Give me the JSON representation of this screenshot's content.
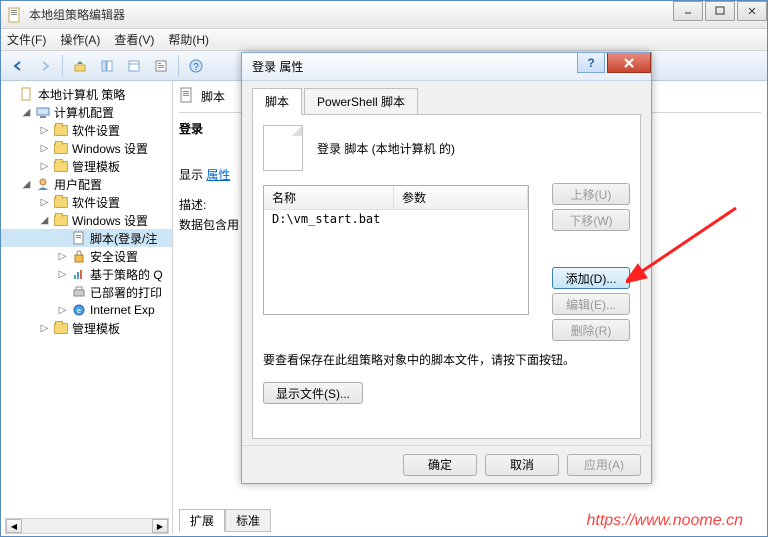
{
  "window": {
    "title": "本地组策略编辑器"
  },
  "menu": {
    "file": "文件(F)",
    "action": "操作(A)",
    "view": "查看(V)",
    "help": "帮助(H)"
  },
  "tree": {
    "root": "本地计算机 策略",
    "computer": "计算机配置",
    "comp_software": "软件设置",
    "comp_windows": "Windows 设置",
    "comp_templates": "管理模板",
    "user": "用户配置",
    "user_software": "软件设置",
    "user_windows": "Windows 设置",
    "scripts": "脚本(登录/注",
    "security": "安全设置",
    "policy_qos": "基于策略的 Q",
    "deployed_print": "已部署的打印",
    "ie": "Internet Exp",
    "user_templates": "管理模板"
  },
  "detail": {
    "header": "脚本",
    "login_label": "登录",
    "show_prefix": "显示",
    "show_link": "属性",
    "desc_label": "描述:",
    "desc_text": "数据包含用"
  },
  "bottom_tabs": {
    "ext": "扩展",
    "std": "标准"
  },
  "dialog": {
    "title": "登录 属性",
    "tab_script": "脚本",
    "tab_ps": "PowerShell 脚本",
    "header": "登录 脚本 (本地计算机 的)",
    "col_name": "名称",
    "col_param": "参数",
    "row_name": "D:\\vm_start.bat",
    "btn_up": "上移(U)",
    "btn_down": "下移(W)",
    "btn_add": "添加(D)...",
    "btn_edit": "编辑(E)...",
    "btn_del": "删除(R)",
    "note": "要查看保存在此组策略对象中的脚本文件，请按下面按钮。",
    "btn_show": "显示文件(S)...",
    "btn_ok": "确定",
    "btn_cancel": "取消",
    "btn_apply": "应用(A)"
  },
  "watermark": "https://www.noome.cn"
}
